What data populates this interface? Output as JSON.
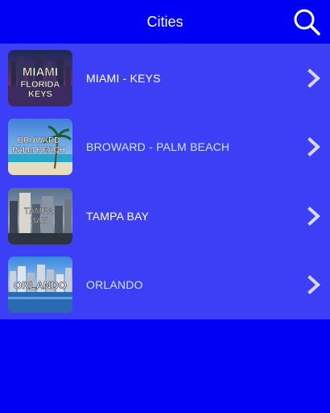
{
  "app_bar": {
    "title": "Cities",
    "search_icon": "search-icon"
  },
  "cities": [
    {
      "label": "MIAMI - KEYS",
      "label_color": "#ffffff",
      "thumb_text": [
        "MIAMI",
        "FLORIDA",
        "KEYS"
      ],
      "icon": "chevron-right-icon"
    },
    {
      "label": "BROWARD - PALM BEACH",
      "label_color": "#cfe6ff",
      "thumb_text": [
        "BROWARD",
        "PALM BEACH"
      ],
      "icon": "chevron-right-icon"
    },
    {
      "label": "TAMPA BAY",
      "label_color": "#ffffff",
      "thumb_text": [
        "TAMPA",
        "BAY"
      ],
      "icon": "chevron-right-icon"
    },
    {
      "label": "ORLANDO",
      "label_color": "#cfe6ff",
      "thumb_text": [
        "ORLANDO"
      ],
      "icon": "chevron-right-icon"
    }
  ],
  "colors": {
    "app_background": "#0000f5",
    "list_background": "#3d3ff7",
    "chevron": "#d8d8ee"
  }
}
